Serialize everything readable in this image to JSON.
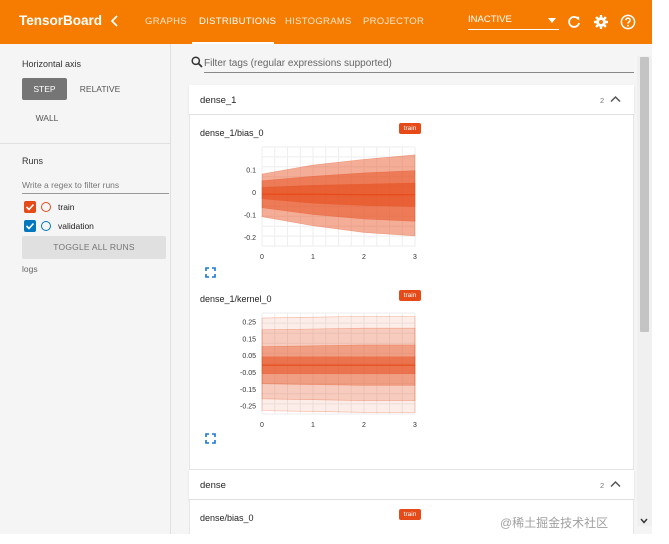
{
  "header": {
    "brand": "TensorBoard",
    "tabs": [
      {
        "label": "GRAPHS",
        "active": false
      },
      {
        "label": "DISTRIBUTIONS",
        "active": true
      },
      {
        "label": "HISTOGRAMS",
        "active": false
      },
      {
        "label": "PROJECTOR",
        "active": false
      }
    ],
    "run_selector": "INACTIVE",
    "icons": [
      "chevron-left-icon",
      "refresh-icon",
      "gear-icon",
      "help-icon"
    ]
  },
  "sidebar": {
    "horizontal_axis_title": "Horizontal axis",
    "axis_options": [
      {
        "label": "STEP",
        "active": true
      },
      {
        "label": "RELATIVE",
        "active": false
      },
      {
        "label": "WALL",
        "active": false
      }
    ],
    "runs_title": "Runs",
    "runs_filter_placeholder": "Write a regex to filter runs",
    "runs": [
      {
        "label": "train",
        "checked": true,
        "color": "#e64a19"
      },
      {
        "label": "validation",
        "checked": true,
        "color": "#0277bd"
      }
    ],
    "toggle_all_label": "TOGGLE ALL RUNS",
    "logdir": "logs"
  },
  "main": {
    "filter_placeholder": "Filter tags (regular expressions supported)",
    "categories": [
      {
        "name": "dense_1",
        "count": "2",
        "charts": [
          {
            "title": "dense_1/bias_0",
            "run_badge": "train",
            "y_ticks": [
              "0.1",
              "0",
              "-0.1",
              "-0.2"
            ],
            "x_ticks": [
              "0",
              "1",
              "2",
              "3"
            ]
          },
          {
            "title": "dense_1/kernel_0",
            "run_badge": "train",
            "y_ticks": [
              "0.25",
              "0.15",
              "0.05",
              "-0.05",
              "-0.15",
              "-0.25"
            ],
            "x_ticks": [
              "0",
              "1",
              "2",
              "3"
            ]
          }
        ]
      },
      {
        "name": "dense",
        "count": "2",
        "charts": [
          {
            "title": "dense/bias_0",
            "run_badge": "train"
          }
        ]
      }
    ]
  },
  "chart_data": [
    {
      "type": "area",
      "title": "dense_1/bias_0",
      "x": [
        0,
        1,
        2,
        3
      ],
      "ylim": [
        -0.24,
        0.2
      ],
      "xlim": [
        0,
        3
      ],
      "grid": true,
      "color": "#e64a19",
      "bands": [
        {
          "lower": [
            -0.11,
            -0.15,
            -0.18,
            -0.195
          ],
          "upper": [
            0.08,
            0.12,
            0.145,
            0.165
          ]
        },
        {
          "lower": [
            -0.07,
            -0.1,
            -0.12,
            -0.13
          ],
          "upper": [
            0.05,
            0.07,
            0.085,
            0.095
          ]
        },
        {
          "lower": [
            -0.03,
            -0.05,
            -0.06,
            -0.065
          ],
          "upper": [
            0.02,
            0.03,
            0.035,
            0.04
          ]
        }
      ],
      "median": [
        -0.01,
        -0.01,
        -0.012,
        -0.012
      ]
    },
    {
      "type": "area",
      "title": "dense_1/kernel_0",
      "x": [
        0,
        1,
        2,
        3
      ],
      "ylim": [
        -0.3,
        0.3
      ],
      "xlim": [
        0,
        3
      ],
      "grid": true,
      "color": "#e64a19",
      "bands": [
        {
          "lower": [
            -0.28,
            -0.285,
            -0.29,
            -0.29
          ],
          "upper": [
            0.27,
            0.275,
            0.28,
            0.28
          ]
        },
        {
          "lower": [
            -0.21,
            -0.215,
            -0.22,
            -0.22
          ],
          "upper": [
            0.2,
            0.205,
            0.21,
            0.21
          ]
        },
        {
          "lower": [
            -0.12,
            -0.125,
            -0.13,
            -0.13
          ],
          "upper": [
            0.1,
            0.105,
            0.11,
            0.11
          ]
        },
        {
          "lower": [
            -0.06,
            -0.06,
            -0.06,
            -0.06
          ],
          "upper": [
            0.04,
            0.04,
            0.04,
            0.04
          ]
        }
      ],
      "median": [
        -0.01,
        -0.01,
        -0.01,
        -0.01
      ]
    }
  ],
  "watermark": "@稀土掘金技术社区"
}
